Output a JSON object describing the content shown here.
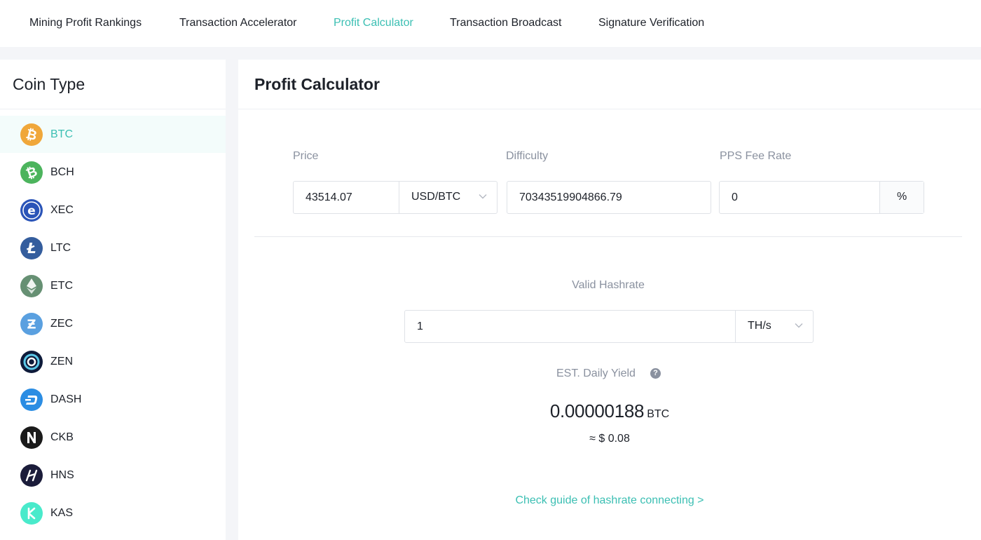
{
  "nav": {
    "tabs": [
      {
        "label": "Mining Profit Rankings"
      },
      {
        "label": "Transaction Accelerator"
      },
      {
        "label": "Profit Calculator"
      },
      {
        "label": "Transaction Broadcast"
      },
      {
        "label": "Signature Verification"
      }
    ],
    "active_tab": "Profit Calculator",
    "accent_color": "#3bbfb3"
  },
  "sidebar": {
    "title": "Coin Type",
    "selected": "BTC",
    "coins": [
      {
        "label": "BTC",
        "icon": "bitcoin-icon",
        "color": "#f0a73a"
      },
      {
        "label": "BCH",
        "icon": "bitcoin-cash-icon",
        "color": "#4cb45d"
      },
      {
        "label": "XEC",
        "icon": "ecash-icon",
        "color": "#2a54b8"
      },
      {
        "label": "LTC",
        "icon": "litecoin-icon",
        "color": "#345d9d"
      },
      {
        "label": "ETC",
        "icon": "ethereum-classic-icon",
        "color": "#669073"
      },
      {
        "label": "ZEC",
        "icon": "zcash-icon",
        "color": "#5aa0e0"
      },
      {
        "label": "ZEN",
        "icon": "horizen-icon",
        "color": "#0e1b3a"
      },
      {
        "label": "DASH",
        "icon": "dash-icon",
        "color": "#2b8de3"
      },
      {
        "label": "CKB",
        "icon": "nervos-icon",
        "color": "#1a1a1a"
      },
      {
        "label": "HNS",
        "icon": "handshake-icon",
        "color": "#1b1c3a"
      },
      {
        "label": "KAS",
        "icon": "kaspa-icon",
        "color": "#49eacb"
      }
    ]
  },
  "calculator": {
    "heading": "Profit Calculator",
    "price": {
      "label": "Price",
      "value": "43514.07",
      "unit": "USD/BTC"
    },
    "difficulty": {
      "label": "Difficulty",
      "value": "70343519904866.79"
    },
    "fee": {
      "label": "PPS Fee Rate",
      "value": "0",
      "unit": "%"
    },
    "hashrate": {
      "label": "Valid Hashrate",
      "value": "1",
      "unit": "TH/s"
    },
    "yield": {
      "label": "EST. Daily Yield",
      "help": "?",
      "value": "0.00000188",
      "unit": "BTC",
      "fiat": "≈ $ 0.08"
    },
    "guide_link": "Check guide of hashrate connecting >"
  }
}
